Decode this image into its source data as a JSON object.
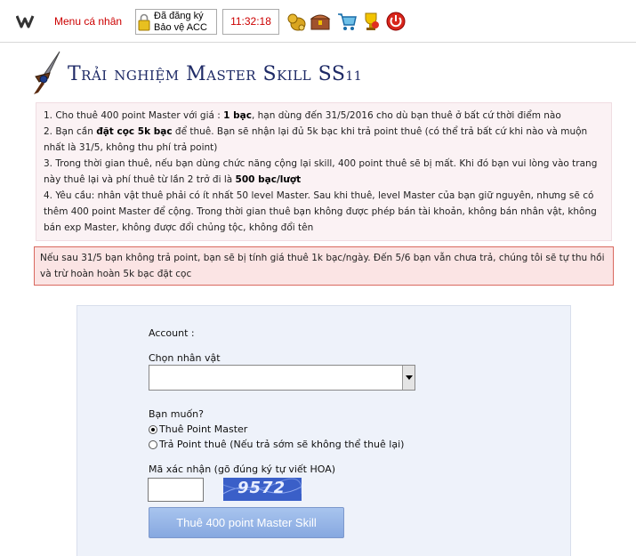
{
  "topbar": {
    "menu_label": "Menu cá nhân",
    "register_line1": "Đã đăng ký",
    "register_line2": "Bảo vệ ACC",
    "clock": "11:32:18"
  },
  "icons": [
    "w-logo-icon",
    "lock-icon",
    "money-bag-icon",
    "treasure-chest-icon",
    "shopping-cart-icon",
    "trophy-icon",
    "power-icon"
  ],
  "page": {
    "title": "Trải nghiệm Master Skill SS",
    "title_suffix": "11"
  },
  "rules": [
    [
      "1. Cho thuê 400 point Master với giá : ",
      "1 bạc",
      ", hạn dùng đến 31/5/2016 cho dù bạn thuê ở bất cứ thời điểm nào"
    ],
    [
      "2. Bạn cần ",
      "đặt cọc 5k bạc",
      " để thuê. Bạn sẽ nhận lại đủ 5k bạc khi trả point thuê (có thể trả bất cứ khi nào và muộn nhất là 31/5, không thu phí trả point)"
    ],
    [
      "3. Trong thời gian thuê, nếu bạn dùng chức năng cộng lại skill, 400 point thuê sẽ bị mất. Khi đó bạn vui lòng vào trang này thuê lại và phí thuê từ lần 2 trở đi là ",
      "500 bạc/lượt",
      ""
    ],
    [
      "4. Yêu cầu: nhân vật thuê phải có ít nhất 50 level Master. Sau khi thuê, level Master của bạn giữ nguyên, nhưng sẽ có thêm 400 point Master để cộng. Trong thời gian thuê bạn không được phép bán tài khoản, không bán nhân vật, không bán exp Master, không được đổi chủng tộc, không đổi tên",
      "",
      ""
    ]
  ],
  "warning": "Nếu sau 31/5 bạn không trả point, bạn sẽ bị tính giá thuê 1k bạc/ngày. Đến 5/6 bạn vẫn chưa trả, chúng tôi sẽ tự thu hồi và trừ hoàn hoàn 5k bạc đặt cọc",
  "form": {
    "account_label": "Account :",
    "character_label": "Chọn nhân vật",
    "character_value": "",
    "want_label": "Bạn muốn?",
    "option_rent": "Thuê Point Master",
    "option_return": "Trả Point thuê (Nếu trả sớm sẽ không thể thuê lại)",
    "captcha_label": "Mã xác nhận (gõ đúng ký tự viết HOA)",
    "captcha_value": "",
    "captcha_code": "9572",
    "submit_label": "Thuê 400 point Master Skill"
  }
}
